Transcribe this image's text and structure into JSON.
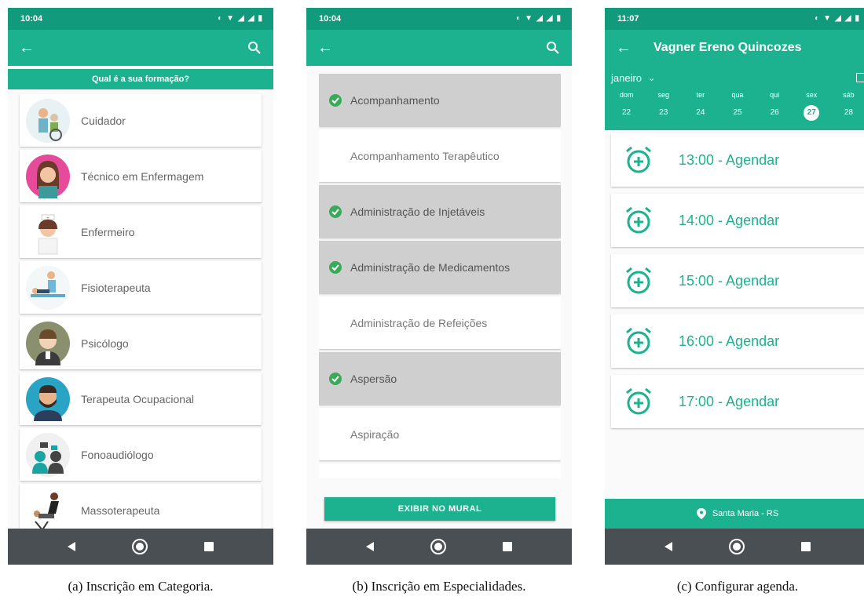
{
  "screens": {
    "categories": {
      "time": "10:04",
      "header": "Qual é a sua formação?",
      "items": [
        {
          "label": "Cuidador",
          "icon": "caregiver-icon"
        },
        {
          "label": "Técnico em Enfermagem",
          "icon": "nurse-technician-icon"
        },
        {
          "label": "Enfermeiro",
          "icon": "nurse-icon"
        },
        {
          "label": "Fisioterapeuta",
          "icon": "physiotherapist-icon"
        },
        {
          "label": "Psicólogo",
          "icon": "psychologist-icon"
        },
        {
          "label": "Terapeuta Ocupacional",
          "icon": "occupational-therapist-icon"
        },
        {
          "label": "Fonoaudiólogo",
          "icon": "speech-therapist-icon"
        },
        {
          "label": "Massoterapeuta",
          "icon": "massage-therapist-icon"
        }
      ]
    },
    "specialties": {
      "time": "10:04",
      "items": [
        {
          "label": "Acompanhamento",
          "checked": true
        },
        {
          "label": "Acompanhamento Terapêutico",
          "checked": false
        },
        {
          "label": "Administração de Injetáveis",
          "checked": true
        },
        {
          "label": "Administração de Medicamentos",
          "checked": true
        },
        {
          "label": "Administração de Refeições",
          "checked": false
        },
        {
          "label": "Aspersão",
          "checked": true
        },
        {
          "label": "Aspiração",
          "checked": false
        }
      ],
      "button_label": "EXIBIR NO MURAL"
    },
    "schedule": {
      "time": "11:07",
      "title": "Vagner Ereno Quincozes",
      "month": "janeiro",
      "days": [
        {
          "name": "dom",
          "num": "22"
        },
        {
          "name": "seg",
          "num": "23"
        },
        {
          "name": "ter",
          "num": "24"
        },
        {
          "name": "qua",
          "num": "25"
        },
        {
          "name": "qui",
          "num": "26"
        },
        {
          "name": "sex",
          "num": "27",
          "selected": true
        },
        {
          "name": "sáb",
          "num": "28"
        }
      ],
      "slots": [
        "13:00 - Agendar",
        "14:00 - Agendar",
        "15:00 - Agendar",
        "16:00 - Agendar",
        "17:00 - Agendar"
      ],
      "location": "Santa Maria - RS"
    }
  },
  "captions": {
    "a": "(a) Inscrição em Categoria.",
    "b": "(b) Inscrição em Especialidades.",
    "c": "(c) Configurar agenda."
  },
  "colors": {
    "primary": "#1db28f",
    "status": "#129a7c",
    "nav": "#4a4f54",
    "selected_card": "#cfcfcf",
    "check": "#3aaa5a"
  }
}
